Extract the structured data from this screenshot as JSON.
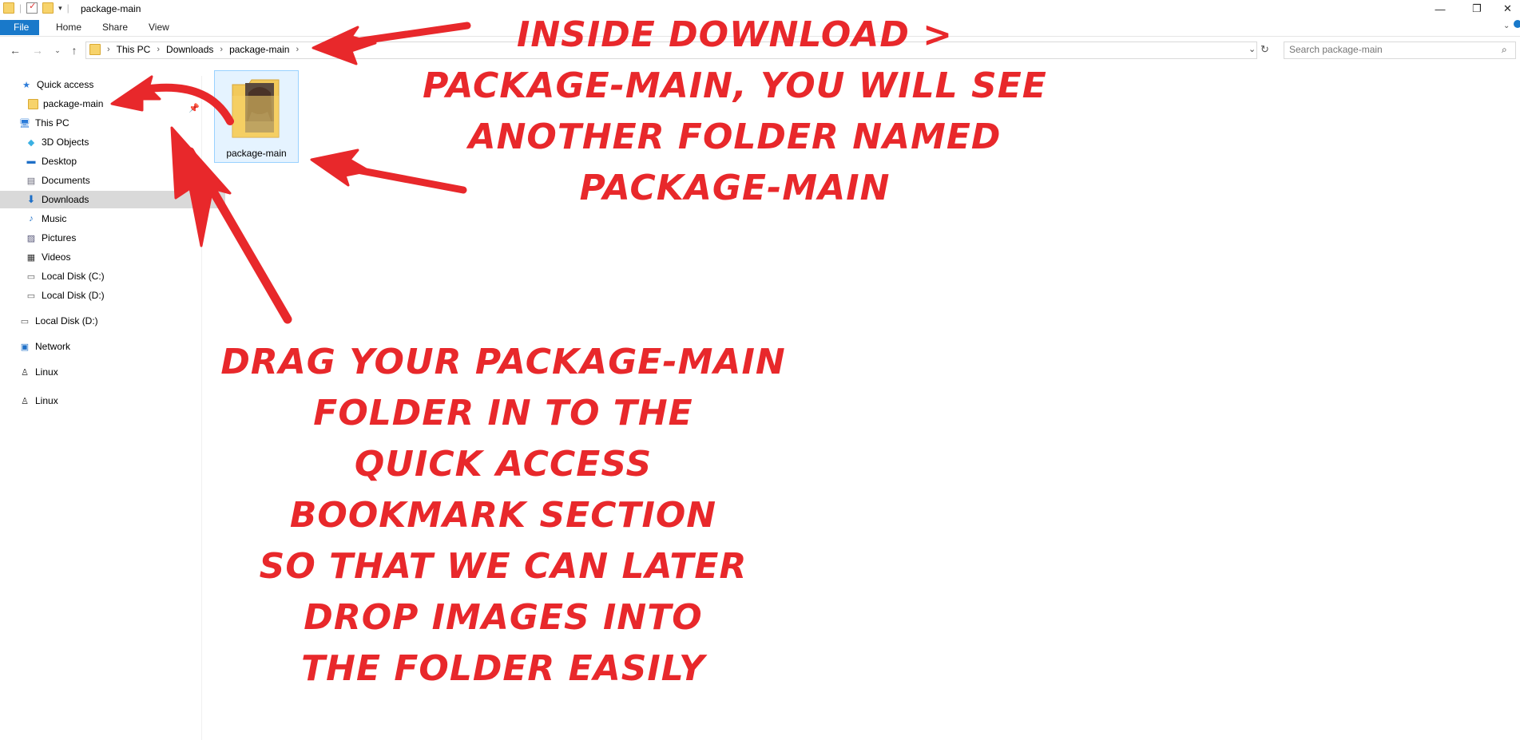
{
  "window": {
    "title": "package-main",
    "minimize_glyph": "—",
    "restore_glyph": "❐",
    "close_glyph": "✕"
  },
  "ribbon": {
    "tabs": [
      "File",
      "Home",
      "Share",
      "View"
    ]
  },
  "address": {
    "crumbs": [
      "This PC",
      "Downloads",
      "package-main"
    ],
    "search_placeholder": "Search package-main"
  },
  "nav": {
    "items": [
      {
        "label": "Quick access",
        "icon": "star-icon"
      },
      {
        "label": "package-main",
        "icon": "folder-icon"
      },
      {
        "label": "This PC",
        "icon": "computer-icon"
      },
      {
        "label": "3D Objects",
        "icon": "cube-icon"
      },
      {
        "label": "Desktop",
        "icon": "desktop-icon"
      },
      {
        "label": "Documents",
        "icon": "documents-icon"
      },
      {
        "label": "Downloads",
        "icon": "download-arrow-icon"
      },
      {
        "label": "Music",
        "icon": "music-note-icon"
      },
      {
        "label": "Pictures",
        "icon": "pictures-icon"
      },
      {
        "label": "Videos",
        "icon": "film-icon"
      },
      {
        "label": "Local Disk (C:)",
        "icon": "drive-icon"
      },
      {
        "label": "Local Disk (D:)",
        "icon": "drive-icon"
      },
      {
        "label": "Local Disk (D:)",
        "icon": "drive-icon"
      },
      {
        "label": "Network",
        "icon": "network-icon"
      },
      {
        "label": "Linux",
        "icon": "penguin-icon"
      },
      {
        "label": "Linux",
        "icon": "penguin-icon"
      }
    ]
  },
  "content": {
    "files": [
      {
        "name": "package-main",
        "type": "folder"
      }
    ]
  },
  "annotations": {
    "top": [
      "Inside download >",
      "package-main, you will see",
      "another folder named",
      "package-main"
    ],
    "bottom": [
      "Drag your package-main",
      "folder in to the",
      "quick access",
      "bookmark section",
      "so that we can later",
      "drop images into",
      "the folder easily"
    ]
  },
  "colors": {
    "accent": "#1979ca",
    "annotation": "#e8282b",
    "selection": "#d9d9d9"
  }
}
